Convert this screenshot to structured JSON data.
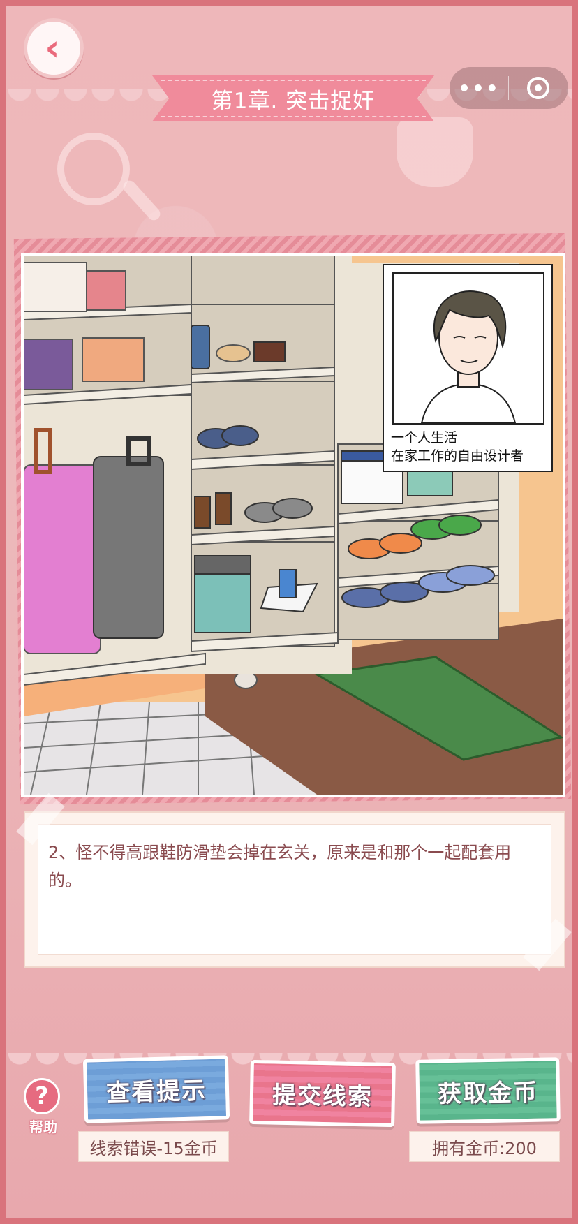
{
  "chapter": {
    "title": "第1章. 突击捉奸"
  },
  "header": {
    "back_icon": "chevron-left-icon",
    "menu_icon": "more-dots-icon",
    "close_icon": "target-circle-icon"
  },
  "profile": {
    "line1": "一个人生活",
    "line2": "在家工作的自由设计者"
  },
  "clue": {
    "text": "2、怪不得高跟鞋防滑垫会掉在玄关，原来是和那个一起配套用的。"
  },
  "buttons": {
    "hint": "查看提示",
    "submit": "提交线索",
    "coins": "获取金币"
  },
  "help": {
    "label": "帮助",
    "symbol": "?"
  },
  "notes": {
    "penalty": "线索错误-15金币",
    "balance": "拥有金币:200"
  },
  "colors": {
    "background": "#e9a9ad",
    "chapter_banner": "#f08b9b",
    "hint_button": "#6d9ed6",
    "submit_button": "#e9758c",
    "coins_button": "#59b58c",
    "text_brown": "#8a4b4f"
  }
}
